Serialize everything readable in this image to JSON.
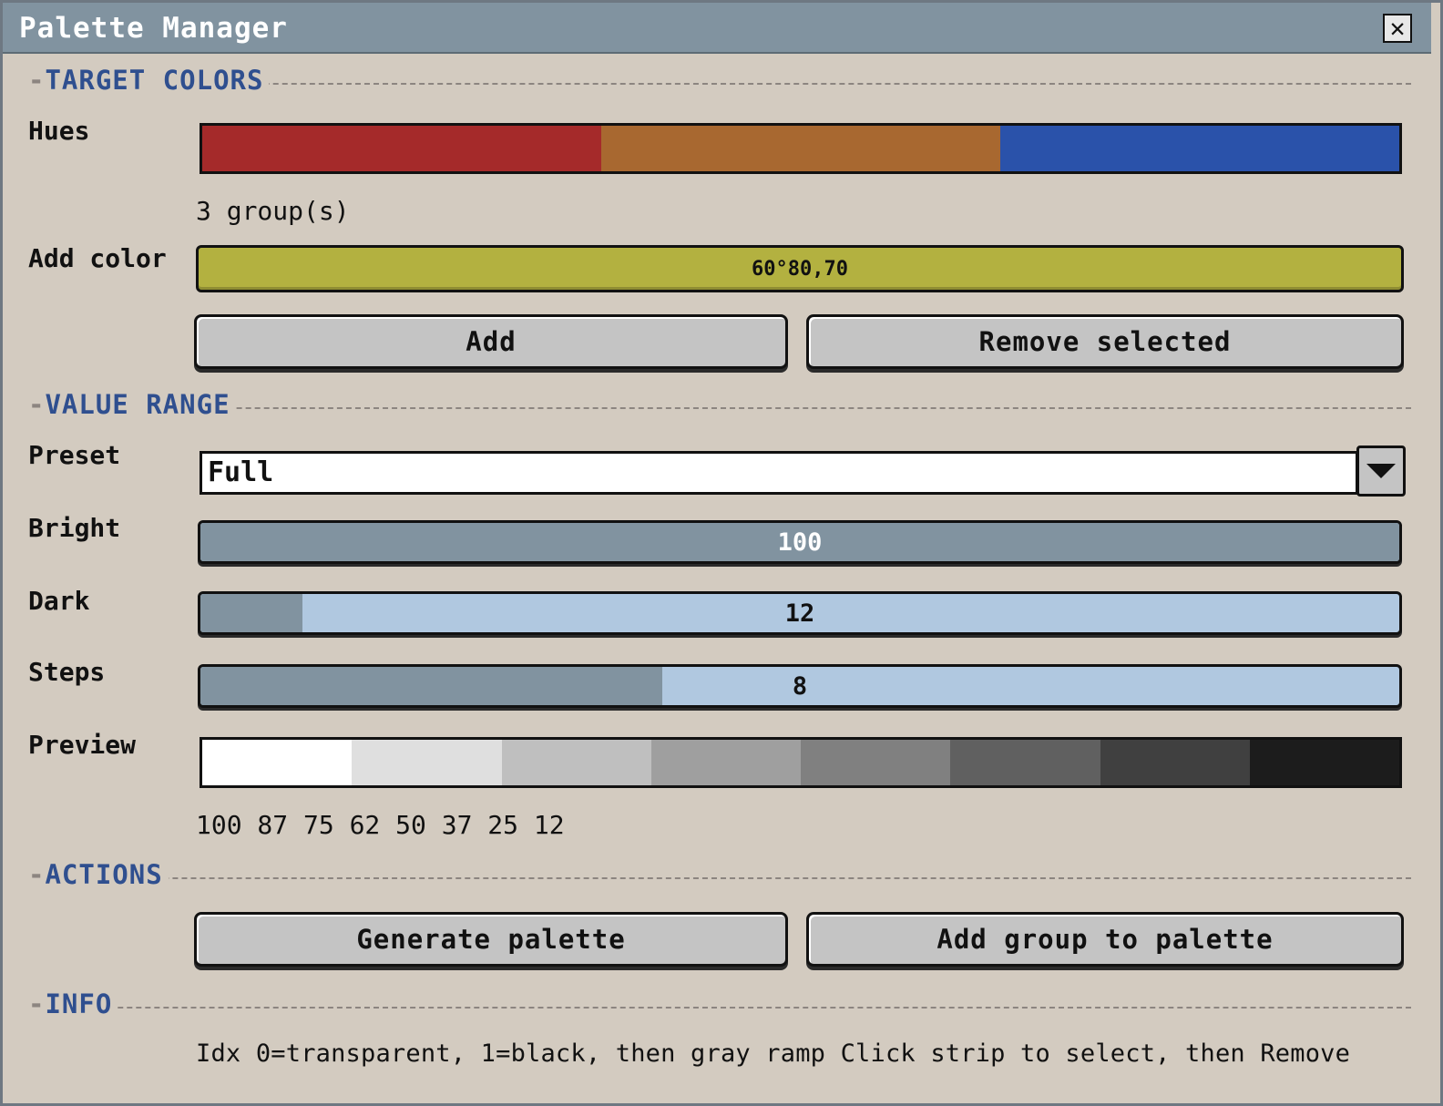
{
  "window": {
    "title": "Palette Manager"
  },
  "sections": {
    "target": "TARGET COLORS",
    "value": "VALUE RANGE",
    "actions": "ACTIONS",
    "info": "INFO"
  },
  "target_colors": {
    "hues_label": "Hues",
    "hues": [
      "#a52a2a",
      "#a86830",
      "#2a52aa"
    ],
    "group_count": "3 group(s)",
    "add_color_label": "Add color",
    "add_color_value": "60°80,70",
    "add_color_swatch": "#b3b140",
    "add_button": "Add",
    "remove_button": "Remove selected"
  },
  "value_range": {
    "preset_label": "Preset",
    "preset_value": "Full",
    "bright_label": "Bright",
    "bright_value": "100",
    "bright_fraction": 1.0,
    "dark_label": "Dark",
    "dark_value": "12",
    "dark_fraction": 0.085,
    "steps_label": "Steps",
    "steps_value": "8",
    "steps_fraction": 0.385,
    "preview_label": "Preview",
    "preview_colors": [
      "#ffffff",
      "#dfdfdf",
      "#bfbfbf",
      "#9f9f9f",
      "#808080",
      "#606060",
      "#404040",
      "#1c1c1c"
    ],
    "preview_values": "100 87 75 62 50 37 25 12"
  },
  "actions": {
    "generate_button": "Generate palette",
    "add_group_button": "Add group to palette"
  },
  "info": {
    "text": "Idx 0=transparent, 1=black, then gray ramp  Click strip to select, then Remove"
  }
}
